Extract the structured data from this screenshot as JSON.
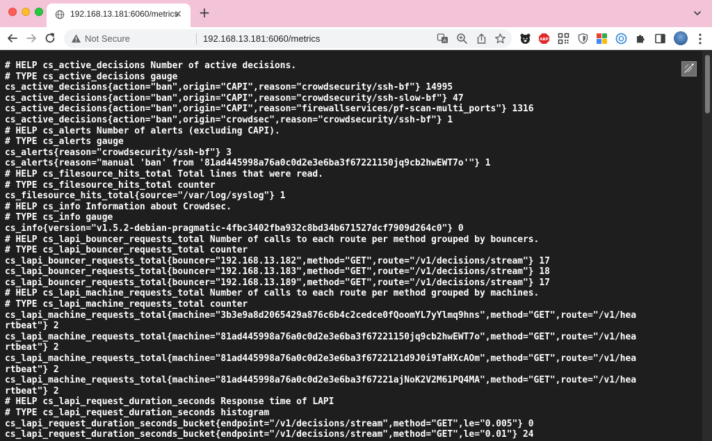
{
  "browser": {
    "tab_title": "192.168.13.181:6060/metrics",
    "tab_close_icon": "close-icon",
    "new_tab_label": "+",
    "security_label": "Not Secure",
    "url": "192.168.13.181:6060/metrics"
  },
  "metrics_lines": [
    "# HELP cs_active_decisions Number of active decisions.",
    "# TYPE cs_active_decisions gauge",
    "cs_active_decisions{action=\"ban\",origin=\"CAPI\",reason=\"crowdsecurity/ssh-bf\"} 14995",
    "cs_active_decisions{action=\"ban\",origin=\"CAPI\",reason=\"crowdsecurity/ssh-slow-bf\"} 47",
    "cs_active_decisions{action=\"ban\",origin=\"CAPI\",reason=\"firewallservices/pf-scan-multi_ports\"} 1316",
    "cs_active_decisions{action=\"ban\",origin=\"crowdsec\",reason=\"crowdsecurity/ssh-bf\"} 1",
    "# HELP cs_alerts Number of alerts (excluding CAPI).",
    "# TYPE cs_alerts gauge",
    "cs_alerts{reason=\"crowdsecurity/ssh-bf\"} 3",
    "cs_alerts{reason=\"manual 'ban' from '81ad445998a76a0c0d2e3e6ba3f67221150jq9cb2hwEWT7o'\"} 1",
    "# HELP cs_filesource_hits_total Total lines that were read.",
    "# TYPE cs_filesource_hits_total counter",
    "cs_filesource_hits_total{source=\"/var/log/syslog\"} 1",
    "# HELP cs_info Information about Crowdsec.",
    "# TYPE cs_info gauge",
    "cs_info{version=\"v1.5.2-debian-pragmatic-4fbc3402fba932c8bd34b671527dcf7909d264c0\"} 0",
    "# HELP cs_lapi_bouncer_requests_total Number of calls to each route per method grouped by bouncers.",
    "# TYPE cs_lapi_bouncer_requests_total counter",
    "cs_lapi_bouncer_requests_total{bouncer=\"192.168.13.182\",method=\"GET\",route=\"/v1/decisions/stream\"} 17",
    "cs_lapi_bouncer_requests_total{bouncer=\"192.168.13.183\",method=\"GET\",route=\"/v1/decisions/stream\"} 18",
    "cs_lapi_bouncer_requests_total{bouncer=\"192.168.13.189\",method=\"GET\",route=\"/v1/decisions/stream\"} 17",
    "# HELP cs_lapi_machine_requests_total Number of calls to each route per method grouped by machines.",
    "# TYPE cs_lapi_machine_requests_total counter",
    "cs_lapi_machine_requests_total{machine=\"3b3e9a8d2065429a876c6b4c2cedce0fQoomYL7yYlmq9hns\",method=\"GET\",route=\"/v1/hea",
    "rtbeat\"} 2",
    "cs_lapi_machine_requests_total{machine=\"81ad445998a76a0c0d2e3e6ba3f67221150jq9cb2hwEWT7o\",method=\"GET\",route=\"/v1/hea",
    "rtbeat\"} 2",
    "cs_lapi_machine_requests_total{machine=\"81ad445998a76a0c0d2e3e6ba3f6722121d9J0i9TaHXcAOm\",method=\"GET\",route=\"/v1/hea",
    "rtbeat\"} 2",
    "cs_lapi_machine_requests_total{machine=\"81ad445998a76a0c0d2e3e6ba3f67221ajNoK2V2M61PQ4MA\",method=\"GET\",route=\"/v1/hea",
    "rtbeat\"} 2",
    "# HELP cs_lapi_request_duration_seconds Response time of LAPI",
    "# TYPE cs_lapi_request_duration_seconds histogram",
    "cs_lapi_request_duration_seconds_bucket{endpoint=\"/v1/decisions/stream\",method=\"GET\",le=\"0.005\"} 0",
    "cs_lapi_request_duration_seconds_bucket{endpoint=\"/v1/decisions/stream\",method=\"GET\",le=\"0.01\"} 24"
  ]
}
